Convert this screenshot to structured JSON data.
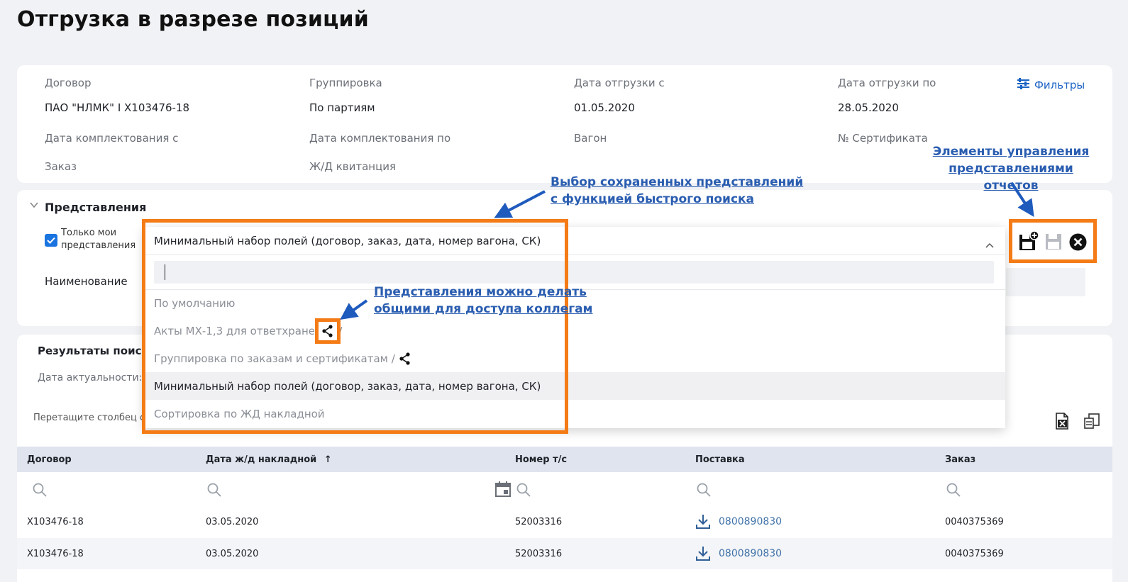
{
  "page": {
    "title": "Отгрузка в разрезе позиций"
  },
  "filters": {
    "contract_label": "Договор",
    "contract_value": "ПАО \"НЛМК\" I Х103476-18",
    "grouping_label": "Группировка",
    "grouping_value": "По партиям",
    "ship_from_label": "Дата отгрузки с",
    "ship_from_value": "01.05.2020",
    "ship_to_label": "Дата отгрузки по",
    "ship_to_value": "28.05.2020",
    "filters_link": "Фильтры",
    "pack_from_label": "Дата комплектования с",
    "pack_to_label": "Дата комплектования по",
    "wagon_label": "Вагон",
    "cert_label": "№ Сертификата",
    "order_label": "Заказ",
    "rail_receipt_label": "Ж/Д квитанция"
  },
  "views": {
    "title": "Представления",
    "only_mine_label": "Только мои представления",
    "only_mine_checked": true,
    "name_label": "Наименование"
  },
  "dropdown": {
    "selected": "Минимальный набор полей (договор, заказ, дата, номер вагона, СК)",
    "search_value": "",
    "items": [
      {
        "label": "По умолчанию",
        "shared": false,
        "active": false
      },
      {
        "label": "Акты МХ-1,3 для ответхранения /",
        "shared": true,
        "active": false
      },
      {
        "label": "Группировка по заказам и сертификатам /",
        "shared": true,
        "active": false
      },
      {
        "label": "Минимальный набор полей (договор, заказ, дата, номер вагона, СК)",
        "shared": false,
        "active": true
      },
      {
        "label": "Сортировка по ЖД накладной",
        "shared": false,
        "active": false
      }
    ]
  },
  "results": {
    "title": "Результаты поиска",
    "actuality_label": "Дата актуальности: 0",
    "drag_hint": "Перетащите столбец сюд"
  },
  "table": {
    "columns": [
      "Договор",
      "Дата ж/д накладной",
      "Номер т/с",
      "Поставка",
      "Заказ"
    ],
    "sort_indicator": "↑",
    "rows": [
      [
        "Х103476-18",
        "03.05.2020",
        "52003316",
        "0800890830",
        "0040375369"
      ],
      [
        "Х103476-18",
        "03.05.2020",
        "52003316",
        "0800890830",
        "0040375369"
      ]
    ]
  },
  "annotations": {
    "views_select_line1": "Выбор сохраненных представлений",
    "views_select_line2": "с функцией быстрого поиска",
    "controls_line1": "Элементы управления",
    "controls_line2": "представлениями отчетов",
    "share_line1": "Представления можно делать",
    "share_line2": "общими для доступа коллегам"
  },
  "colors": {
    "accent_orange": "#f47b16",
    "link_blue": "#1b62c4",
    "annotation_blue": "#2a5db0",
    "checkbox_blue": "#1a74e0"
  },
  "icons": {
    "filters": "sliders-icon",
    "add_view": "add-view-icon",
    "save_view": "save-icon",
    "delete_view": "close-circle-icon",
    "share": "share-icon",
    "excel": "excel-export-icon",
    "columns": "columns-icon",
    "search": "search-icon",
    "calendar": "calendar-icon",
    "download": "download-icon"
  }
}
